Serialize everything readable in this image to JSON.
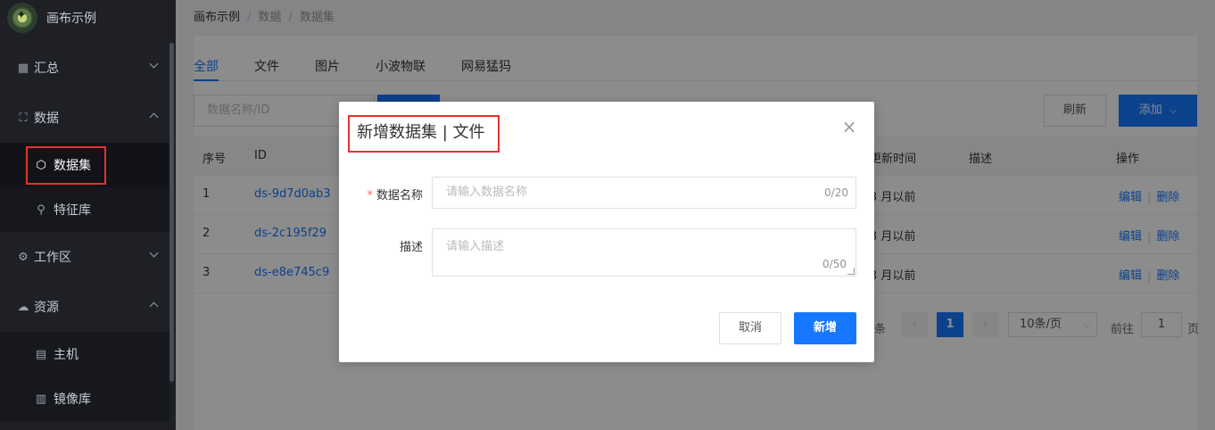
{
  "app": {
    "title": "画布示例"
  },
  "sidebar": {
    "groups": [
      {
        "label": "汇总",
        "icon": "dashboard-icon"
      },
      {
        "label": "数据",
        "icon": "hierarchy-icon"
      },
      {
        "label": "工作区",
        "icon": "gear-icon"
      },
      {
        "label": "资源",
        "icon": "cloud-icon"
      }
    ],
    "subitems": [
      {
        "label": "数据集",
        "icon": "cube-icon",
        "active": true
      },
      {
        "label": "特征库",
        "icon": "features-icon"
      },
      {
        "label": "主机",
        "icon": "server-icon"
      },
      {
        "label": "镜像库",
        "icon": "image-repo-icon"
      }
    ]
  },
  "breadcrumb": {
    "items": [
      "画布示例",
      "数据",
      "数据集"
    ],
    "separator": "/"
  },
  "tabs": [
    "全部",
    "文件",
    "图片",
    "小波物联",
    "网易猛犸"
  ],
  "toolbar": {
    "search_placeholder": "数据名称/ID",
    "refresh_label": "刷新",
    "add_label": "添加"
  },
  "table": {
    "columns": [
      "序号",
      "ID",
      "更新时间",
      "描述",
      "操作"
    ],
    "rows": [
      {
        "index": "1",
        "id": "ds-9d7d0ab3",
        "updated": "3 月以前",
        "edit": "编辑",
        "delete": "删除"
      },
      {
        "index": "2",
        "id": "ds-2c195f29",
        "updated": "3 月以前",
        "edit": "编辑",
        "delete": "删除"
      },
      {
        "index": "3",
        "id": "ds-e8e745c9",
        "updated": "3 月以前",
        "edit": "编辑",
        "delete": "删除"
      }
    ]
  },
  "pagination": {
    "total_suffix": "条",
    "current_page": "1",
    "page_size": "10条/页",
    "goto_prefix": "前往",
    "goto_value": "1",
    "goto_suffix": "页"
  },
  "modal": {
    "title": "新增数据集 | 文件",
    "name_label": "数据名称",
    "name_placeholder": "请输入数据名称",
    "name_count": "0/20",
    "desc_label": "描述",
    "desc_placeholder": "请输入描述",
    "desc_count": "0/50",
    "cancel_label": "取消",
    "submit_label": "新增"
  },
  "colors": {
    "primary": "#1677ff",
    "sidebar_bg": "#1e2026",
    "highlight": "#e5322d"
  }
}
